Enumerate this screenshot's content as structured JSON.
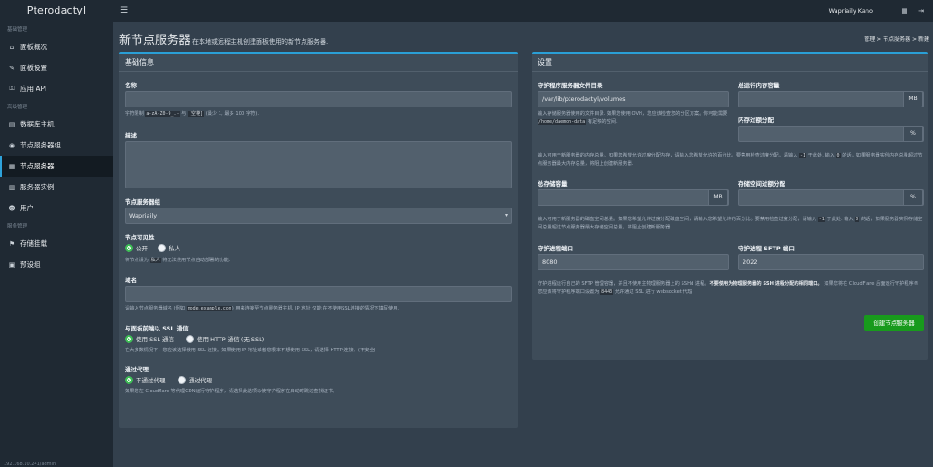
{
  "brand": "Pterodactyl",
  "sidebar": {
    "sec1": "基础管理",
    "items1": [
      {
        "icon": "⌂",
        "label": "面板概况"
      },
      {
        "icon": "✎",
        "label": "面板设置"
      },
      {
        "icon": "⚿",
        "label": "应用 API"
      }
    ],
    "sec2": "高级管理",
    "items2": [
      {
        "icon": "▤",
        "label": "数据库主机"
      },
      {
        "icon": "◉",
        "label": "节点服务器组"
      },
      {
        "icon": "▦",
        "label": "节点服务器"
      },
      {
        "icon": "▥",
        "label": "服务器实例"
      },
      {
        "icon": "☻",
        "label": "用户"
      }
    ],
    "sec3": "服务管理",
    "items3": [
      {
        "icon": "⚑",
        "label": "存储挂载"
      },
      {
        "icon": "▣",
        "label": "预设组"
      }
    ],
    "version": "192.168.10.241/admin"
  },
  "topbar": {
    "user": "Wapriaily Kano"
  },
  "header": {
    "title": "新节点服务器",
    "subtitle": "在本地或远程主机创建面板使用的新节点服务器.",
    "breadcrumb": [
      "管理",
      "节点服务器",
      "新建"
    ],
    "sep": ">"
  },
  "basic": {
    "title": "基础信息",
    "name_label": "名称",
    "name_help_a": "字符限制 ",
    "name_help_code1": "a-zA-Z0-9_.-",
    "name_help_b": " 与 ",
    "name_help_code2": "[空格]",
    "name_help_c": " (最少 1, 最多 100 字符).",
    "desc_label": "描述",
    "loc_label": "节点服务器组",
    "loc_value": "Wapriaily",
    "vis_label": "节点可见性",
    "vis_public": "公开",
    "vis_private": "私人",
    "vis_help_a": "将节点设为 ",
    "vis_help_code": "私人",
    "vis_help_b": " 将无法使用节点自动部署的功能.",
    "fqdn_label": "域名",
    "fqdn_help_a": "请输入节点服务器域名 (例如 ",
    "fqdn_help_code": "node.example.com",
    "fqdn_help_b": ") 用来连接至节点服务器主机. IP 地址 仅能 在不使用SSL连接的情况下填写使用.",
    "ssl_label": "与面板前端以 SSL 通信",
    "ssl_yes": "使用 SSL 通信",
    "ssl_no": "使用 HTTP 通信 (无 SSL)",
    "ssl_help": "在大多数情况下，您应该选择使用 SSL 连接。如果使用 IP 地址或者您根本不想使用 SSL，请选择 HTTP 连接。(不安全)",
    "proxy_label": "通过代理",
    "proxy_no": "不通过代理",
    "proxy_yes": "通过代理",
    "proxy_help": "如果您在 Cloudflare 等代理CDN运行守护程序，请选择此选项以使守护程序在启动时跳过查找证书。"
  },
  "settings": {
    "title": "设置",
    "dir_label": "守护程序服务器文件目录",
    "dir_value": "/var/lib/pterodactyl/volumes",
    "dir_help_a": "输入存储服务器使用的文件目录. 如果您使用 OVH，您应该检查您的分区方案。你可能需要 ",
    "dir_help_code": "/home/daemon-data",
    "dir_help_b": " 有足够的空间.",
    "mem_label": "总运行内存容量",
    "mem_unit": "MB",
    "memover_label": "内存过额分配",
    "pct": "%",
    "mem_help_a": "输入可用于新服务器的内存总量。如果您希望允许过度分配内存，请输入您希望允许的百分比。要禁用检查过度分配，请输入 ",
    "mem_help_code1": "-1",
    "mem_help_b": " 于此处. 输入 ",
    "mem_help_code2": "0",
    "mem_help_c": " 的话，如果服务器实例内存总量超过节点服务器最大内存总量，将阻止创建新服务器.",
    "disk_label": "总存储容量",
    "disk_unit": "MB",
    "diskover_label": "存储空间过额分配",
    "disk_help_a": "输入可用于新服务器的磁盘空间总量。如果您希望允许过度分配磁盘空间，请输入您希望允许的百分比。要禁用检查过度分配，请输入 ",
    "disk_help_code1": "-1",
    "disk_help_b": " 于此处. 输入 ",
    "disk_help_code2": "0",
    "disk_help_c": " 的话，如果服务器实例存储空间总量超过节点服务器最大存储空间总量，将阻止创建新服务器.",
    "port_label": "守护进程端口",
    "port_value": "8080",
    "sftp_label": "守护进程 SFTP 端口",
    "sftp_value": "2022",
    "port_help_a": "守护进程运行自己的 SFTP 管理容器，并且不使用主物理服务器上的 SSHd 进程。",
    "port_help_bold": "不要使用为物理服务器的 SSH 进程分配的相同端口。",
    "port_help_b": " 如果您将在 CloudFlare 后面运行守护程序® 您应该将守护程序端口设置为 ",
    "port_help_code": "8443",
    "port_help_c": " 允许通过 SSL 进行 websocket 代理",
    "submit": "创建节点服务器"
  },
  "colors": {
    "accent": "#2a9fd6",
    "success": "#189a1c",
    "sidebar": "#1f2933",
    "bg": "#33404d",
    "box": "#3e4c59"
  }
}
